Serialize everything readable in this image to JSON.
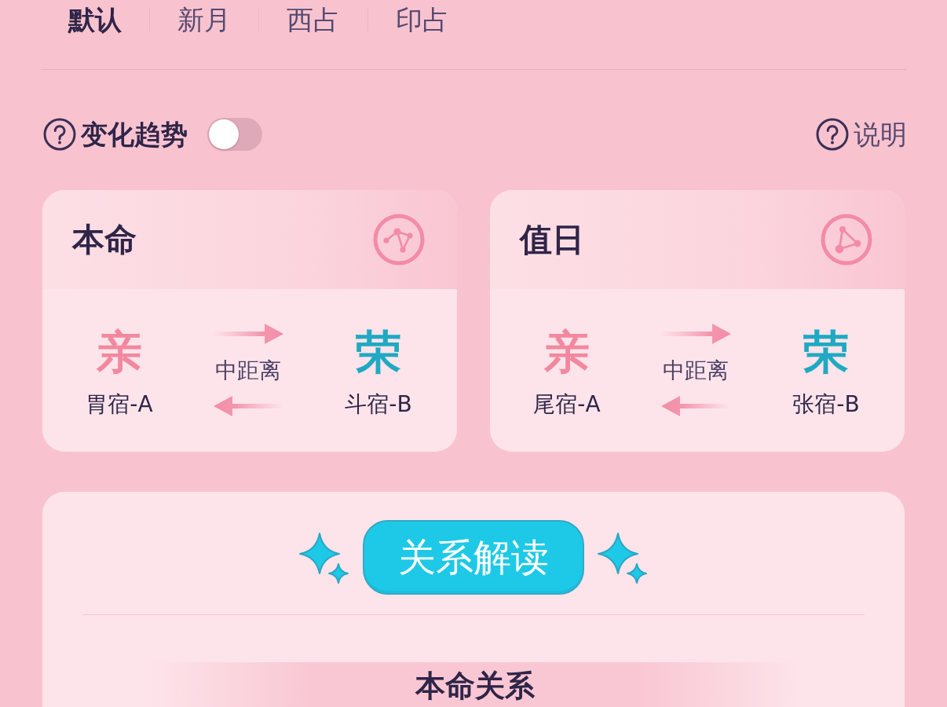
{
  "tabs": [
    {
      "label": "默认",
      "selected": true
    },
    {
      "label": "新月",
      "selected": false
    },
    {
      "label": "西占",
      "selected": false
    },
    {
      "label": "印占",
      "selected": false
    }
  ],
  "trend_toggle": {
    "label": "变化趋势",
    "on": false
  },
  "help_link": {
    "label": "说明"
  },
  "cards": [
    {
      "title": "本命",
      "parties": [
        {
          "relation": "亲",
          "name": "胃宿-A",
          "color": "#f2889f"
        },
        {
          "relation": "荣",
          "name": "斗宿-B",
          "color": "#20a9c2"
        }
      ],
      "distance": "中距离"
    },
    {
      "title": "值日",
      "parties": [
        {
          "relation": "亲",
          "name": "尾宿-A",
          "color": "#f2889f"
        },
        {
          "relation": "荣",
          "name": "张宿-B",
          "color": "#20a9c2"
        }
      ],
      "distance": "中距离"
    }
  ],
  "interpretation": {
    "button": "关系解读",
    "section_title": "本命关系"
  }
}
